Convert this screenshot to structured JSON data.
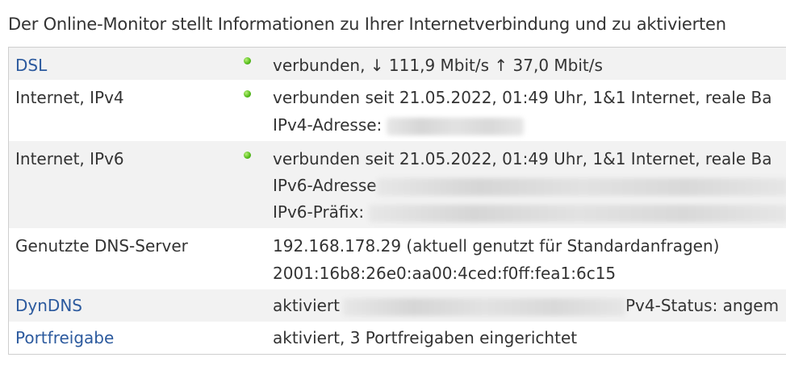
{
  "intro": "Der Online-Monitor stellt Informationen zu Ihrer Internetverbindung und zu aktivierten",
  "rows": [
    {
      "label": "DSL",
      "status": "verbunden, ↓ 111,9 Mbit/s ↑ 37,0 Mbit/s",
      "indicator": "green-dot"
    },
    {
      "label": "Internet, IPv4",
      "line1": "verbunden seit 21.05.2022, 01:49 Uhr, 1&1 Internet, reale Ba",
      "line2": "IPv4-Adresse:",
      "indicator": "green-dot"
    },
    {
      "label": "Internet, IPv6",
      "line1": "verbunden seit 21.05.2022, 01:49 Uhr, 1&1 Internet, reale Ba",
      "line2": "IPv6-Adresse",
      "line3": "IPv6-Präfix: ",
      "indicator": "green-dot"
    },
    {
      "label": "Genutzte DNS-Server",
      "line1": "192.168.178.29 (aktuell genutzt für Standardanfragen)",
      "line2": "2001:16b8:26e0:aa00:4ced:f0ff:fea1:6c15"
    },
    {
      "label": "DynDNS",
      "text1": "aktiviert",
      "text2": "Pv4-Status: angem"
    },
    {
      "label": "Portfreigabe",
      "status": "aktiviert, 3 Portfreigaben eingerichtet"
    }
  ],
  "colors": {
    "link": "#2c5a9e",
    "alt_row": "#f2f2f2",
    "status_ok": "#5ac01f"
  }
}
